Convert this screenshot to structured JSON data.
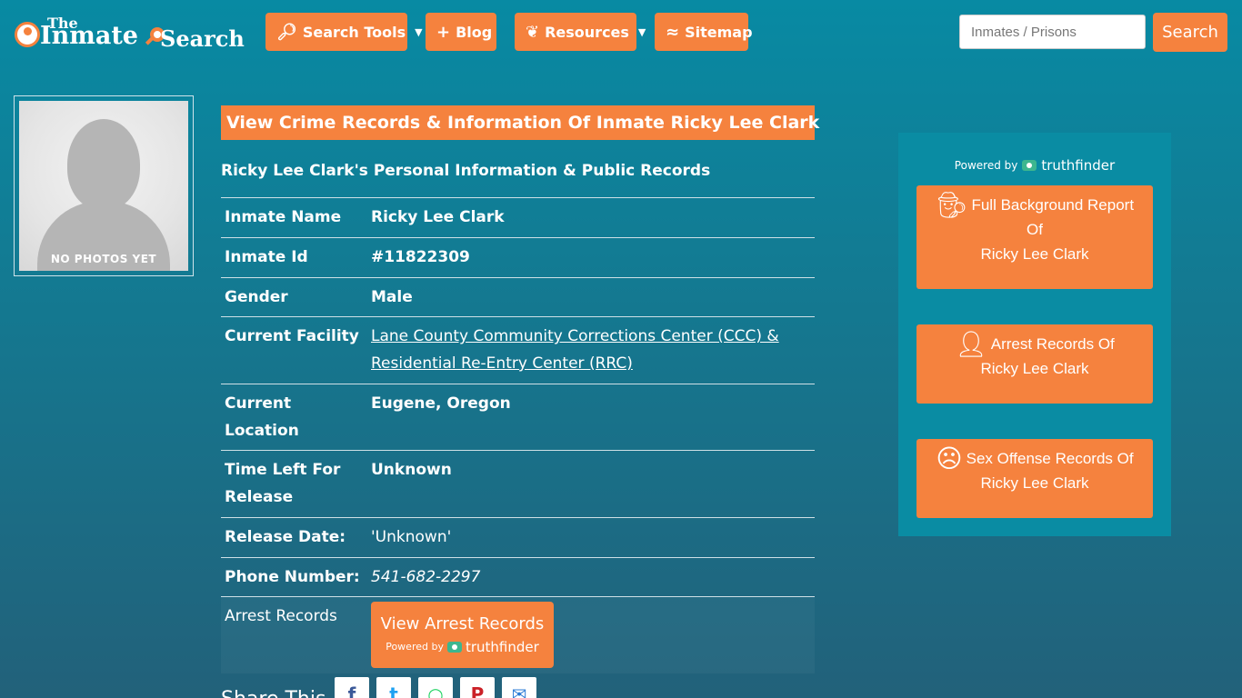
{
  "logo": {
    "the": "The",
    "inmate": "Inmate",
    "search": "Search"
  },
  "nav": {
    "search_tools": "Search Tools",
    "blog": "Blog",
    "resources": "Resources",
    "sitemap": "Sitemap"
  },
  "search": {
    "placeholder": "Inmates / Prisons",
    "button": "Search"
  },
  "photo": {
    "caption": "NO PHOTOS YET"
  },
  "main": {
    "title": "View Crime Records & Information Of Inmate Ricky Lee Clark",
    "subtitle": "Ricky Lee Clark's Personal Information & Public Records"
  },
  "records": {
    "inmate_name": {
      "label": "Inmate Name",
      "value": "Ricky Lee Clark"
    },
    "inmate_id": {
      "label": "Inmate Id",
      "value": "#11822309"
    },
    "gender": {
      "label": "Gender",
      "value": "Male"
    },
    "facility": {
      "label": "Current Facility",
      "value": "Lane County Community Corrections Center (CCC) & Residential Re-Entry Center (RRC)"
    },
    "location": {
      "label": "Current Location",
      "value": "Eugene, Oregon"
    },
    "time_left": {
      "label": "Time Left For Release",
      "value": "Unknown"
    },
    "release_date": {
      "label": "Release Date:",
      "value": "'Unknown'"
    },
    "phone": {
      "label": "Phone Number:",
      "value": "541-682-2297"
    },
    "arrest": {
      "label": "Arrest Records",
      "button": "View Arrest Records",
      "powered_by": "Powered by",
      "brand": "truthfinder"
    }
  },
  "share": {
    "label": "Share This"
  },
  "sidebar": {
    "powered_by": "Powered by",
    "brand": "truthfinder",
    "buttons": [
      {
        "line1": "Full Background Report",
        "line2": "Of",
        "line3": "Ricky Lee Clark",
        "icon": "spy-icon"
      },
      {
        "line1": "Arrest Records Of",
        "line2": "Ricky Lee Clark",
        "icon": "user-lock-icon"
      },
      {
        "line1": "Sex Offense Records Of",
        "line2": "Ricky Lee Clark",
        "icon": "angry-face-icon"
      }
    ]
  },
  "colors": {
    "accent": "#f5823e",
    "bg_top": "#088aa3",
    "bg_bottom": "#22617a",
    "sidebar": "#0a8ca3"
  }
}
